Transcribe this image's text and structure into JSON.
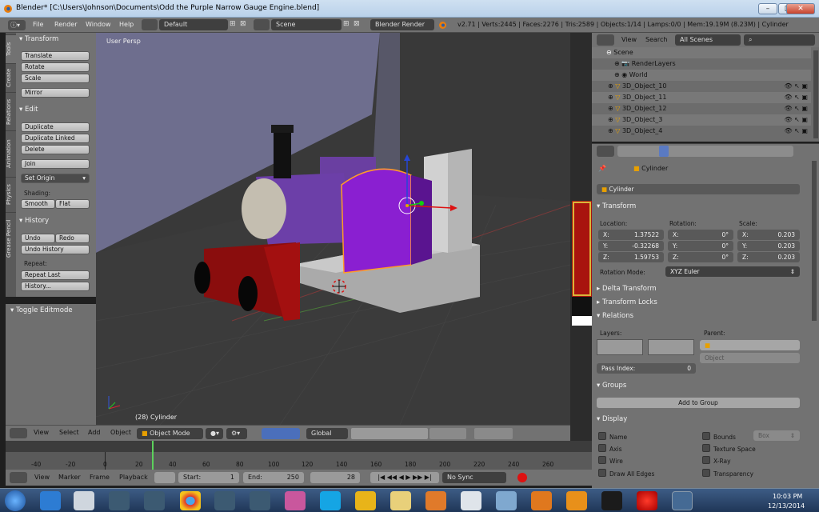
{
  "window": {
    "title": "Blender* [C:\\Users\\Johnson\\Documents\\Odd the Purple Narrow Gauge Engine.blend]",
    "min": "–",
    "max": "□",
    "close": "✕"
  },
  "menubar": {
    "items": [
      "File",
      "Render",
      "Window",
      "Help"
    ],
    "layout": "Default",
    "scene": "Scene",
    "engine": "Blender Render",
    "stats": "v2.71 | Verts:2445 | Faces:2276 | Tris:2589 | Objects:1/14 | Lamps:0/0 | Mem:19.19M (8.23M) | Cylinder"
  },
  "tabs": [
    "Tools",
    "Create",
    "Relations",
    "Animation",
    "Physics",
    "Grease Pencil"
  ],
  "toolshelf": {
    "transform_header": "Transform",
    "translate": "Translate",
    "rotate": "Rotate",
    "scale": "Scale",
    "mirror": "Mirror",
    "edit_header": "Edit",
    "duplicate": "Duplicate",
    "duplicate_linked": "Duplicate Linked",
    "delete": "Delete",
    "join": "Join",
    "set_origin": "Set Origin",
    "shading_label": "Shading:",
    "smooth": "Smooth",
    "flat": "Flat",
    "history_header": "History",
    "undo": "Undo",
    "redo": "Redo",
    "undo_history": "Undo History",
    "repeat_label": "Repeat:",
    "repeat_last": "Repeat Last",
    "history": "History...",
    "toggle_editmode": "Toggle Editmode"
  },
  "viewport": {
    "persp_label": "User Persp",
    "object_label": "(28) Cylinder"
  },
  "viewport_header": {
    "view": "View",
    "select": "Select",
    "add": "Add",
    "object": "Object",
    "mode": "Object Mode",
    "orientation": "Global"
  },
  "outliner": {
    "view": "View",
    "search": "Search",
    "scenes": "All Scenes",
    "rows": [
      "Scene",
      "RenderLayers",
      "World",
      "3D_Object_10",
      "3D_Object_11",
      "3D_Object_12",
      "3D_Object_3",
      "3D_Object_4"
    ]
  },
  "properties": {
    "object_name": "Cylinder",
    "object_field": "Cylinder",
    "transform_header": "Transform",
    "location_label": "Location:",
    "rotation_label": "Rotation:",
    "scale_label": "Scale:",
    "loc": [
      {
        "axis": "X:",
        "value": "1.37522"
      },
      {
        "axis": "Y:",
        "value": "-0.32268"
      },
      {
        "axis": "Z:",
        "value": "1.59753"
      }
    ],
    "rot": [
      {
        "axis": "X:",
        "value": "0°"
      },
      {
        "axis": "Y:",
        "value": "0°"
      },
      {
        "axis": "Z:",
        "value": "0°"
      }
    ],
    "scl": [
      {
        "axis": "X:",
        "value": "0.203"
      },
      {
        "axis": "Y:",
        "value": "0.203"
      },
      {
        "axis": "Z:",
        "value": "0.203"
      }
    ],
    "rotation_mode_label": "Rotation Mode:",
    "rotation_mode": "XYZ Euler",
    "delta_transform": "Delta Transform",
    "transform_locks": "Transform Locks",
    "relations": "Relations",
    "layers_label": "Layers:",
    "parent_label": "Parent:",
    "parent_type": "Object",
    "pass_index_label": "Pass Index:",
    "pass_index": "0",
    "groups": "Groups",
    "add_to_group": "Add to Group",
    "display": "Display",
    "name": "Name",
    "axis": "Axis",
    "wire": "Wire",
    "draw_all_edges": "Draw All Edges",
    "bounds": "Bounds",
    "bounds_type": "Box",
    "texture_space": "Texture Space",
    "xray": "X-Ray",
    "transparency": "Transparency"
  },
  "timeline": {
    "ticks": [
      "-40",
      "-20",
      "0",
      "20",
      "40",
      "60",
      "80",
      "100",
      "120",
      "140",
      "160",
      "180",
      "200",
      "220",
      "240",
      "260"
    ],
    "view": "View",
    "marker": "Marker",
    "frame": "Frame",
    "playback": "Playback",
    "start_label": "Start:",
    "start": "1",
    "end_label": "End:",
    "end": "250",
    "current": "28",
    "sync": "No Sync"
  },
  "taskbar": {
    "time": "10:03 PM",
    "date": "12/13/2014"
  }
}
